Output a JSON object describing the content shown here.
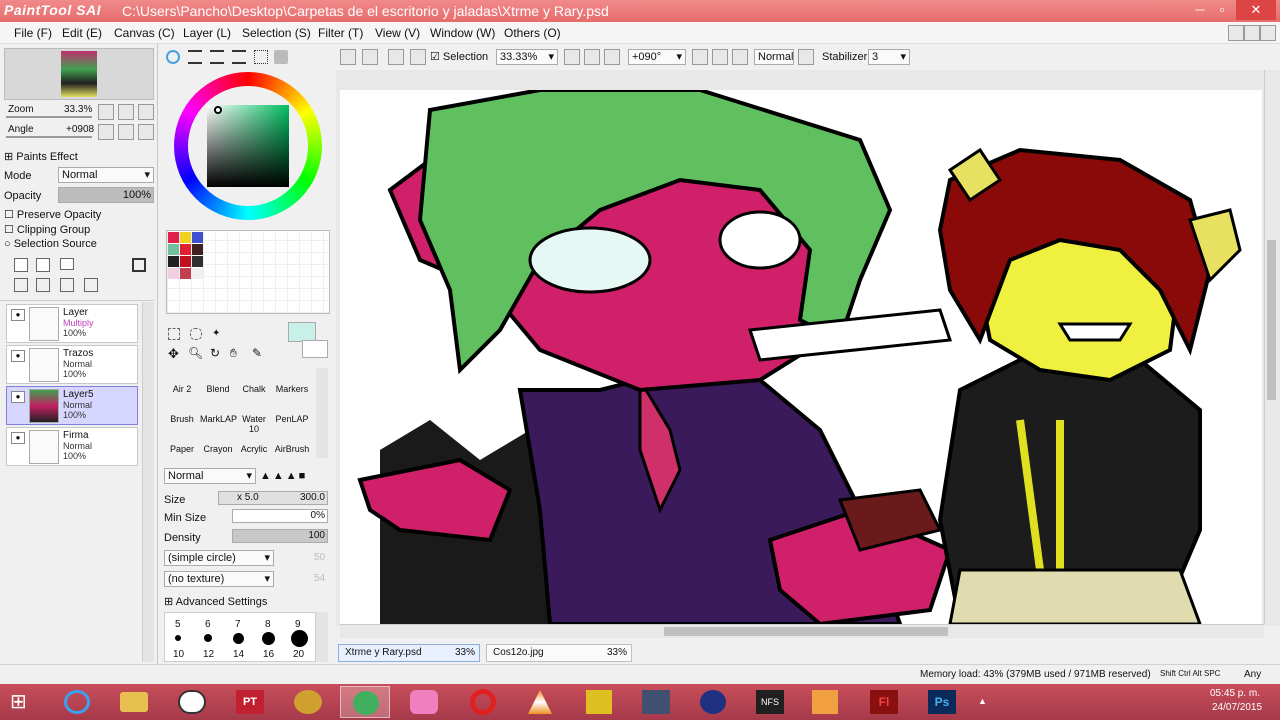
{
  "window": {
    "app_logo": "PaintTool SAI",
    "title": "C:\\Users\\Pancho\\Desktop\\Carpetas de el escritorio y jaladas\\Xtrme y Rary.psd",
    "minimize": "─",
    "maximize": "▫",
    "close": "✕"
  },
  "menu": [
    "File (F)",
    "Edit (E)",
    "Canvas (C)",
    "Layer (L)",
    "Selection (S)",
    "Filter (T)",
    "View (V)",
    "Window (W)",
    "Others (O)"
  ],
  "navigator": {
    "zoom_label": "Zoom",
    "zoom_value": "33.3%",
    "angle_label": "Angle",
    "angle_value": "+0908"
  },
  "paints_effect": {
    "header": "Paints Effect",
    "mode_label": "Mode",
    "mode_value": "Normal",
    "opacity_label": "Opacity",
    "opacity_value": "100%",
    "opacity_fraction": 1.0,
    "preserve_opacity": "Preserve Opacity",
    "clipping_group": "Clipping Group",
    "selection_source": "Selection Source"
  },
  "layers": [
    {
      "name": "Layer",
      "mode": "Multiply",
      "opacity": "100%",
      "selected": false
    },
    {
      "name": "Trazos",
      "mode": "Normal",
      "opacity": "100%",
      "selected": false
    },
    {
      "name": "Layer5",
      "mode": "Normal",
      "opacity": "100%",
      "selected": true
    },
    {
      "name": "Firma",
      "mode": "Normal",
      "opacity": "100%",
      "selected": false
    }
  ],
  "toolbar": {
    "selection_label": "Selection",
    "selection_checked": true,
    "zoom_value": "33.33%",
    "rotation_value": "+090°",
    "blend_value": "Normal",
    "stabilizer_label": "Stabilizer",
    "stabilizer_value": "3"
  },
  "swatches": [
    "#e0204a",
    "#f0d020",
    "#4050d0",
    "#70c0a0",
    "#e02030",
    "#402020",
    "#202020",
    "#c01020",
    "#303030",
    "#f0d0e0",
    "#c04050",
    "#f0f0f0"
  ],
  "brushes": {
    "row1": [
      "Air 2",
      "Blend",
      "Chalk",
      "Markers"
    ],
    "row2": [
      "Brush",
      "MarkLAP",
      "Water 10",
      "PenLAP"
    ],
    "row3": [
      "Paper",
      "Crayon",
      "Acrylic",
      "AirBrush"
    ]
  },
  "brush_settings": {
    "mode_value": "Normal",
    "size_label": "Size",
    "size_mult": "x 5.0",
    "size_value": "300.0",
    "minsize_label": "Min Size",
    "minsize_value": "0%",
    "density_label": "Density",
    "density_value": "100",
    "density_fraction": 1.0,
    "shape_value": "(simple circle)",
    "shape_num": "50",
    "texture_value": "(no texture)",
    "texture_num": "54",
    "advanced": "Advanced Settings"
  },
  "dot_sizes": {
    "top": [
      "5",
      "6",
      "7",
      "8",
      "9"
    ],
    "bottom": [
      "10",
      "12",
      "14",
      "16",
      "20"
    ]
  },
  "tabs": [
    {
      "name": "Xtrme y Rary.psd",
      "pct": "33%"
    },
    {
      "name": "Cos12o.jpg",
      "pct": "33%"
    }
  ],
  "status": {
    "memory": "Memory load: 43% (379MB used / 971MB reserved)",
    "keys": "Shift Ctrl Alt SPC",
    "any": "Any"
  },
  "taskbar": {
    "time": "05:45 p. m.",
    "date": "24/07/2015"
  }
}
